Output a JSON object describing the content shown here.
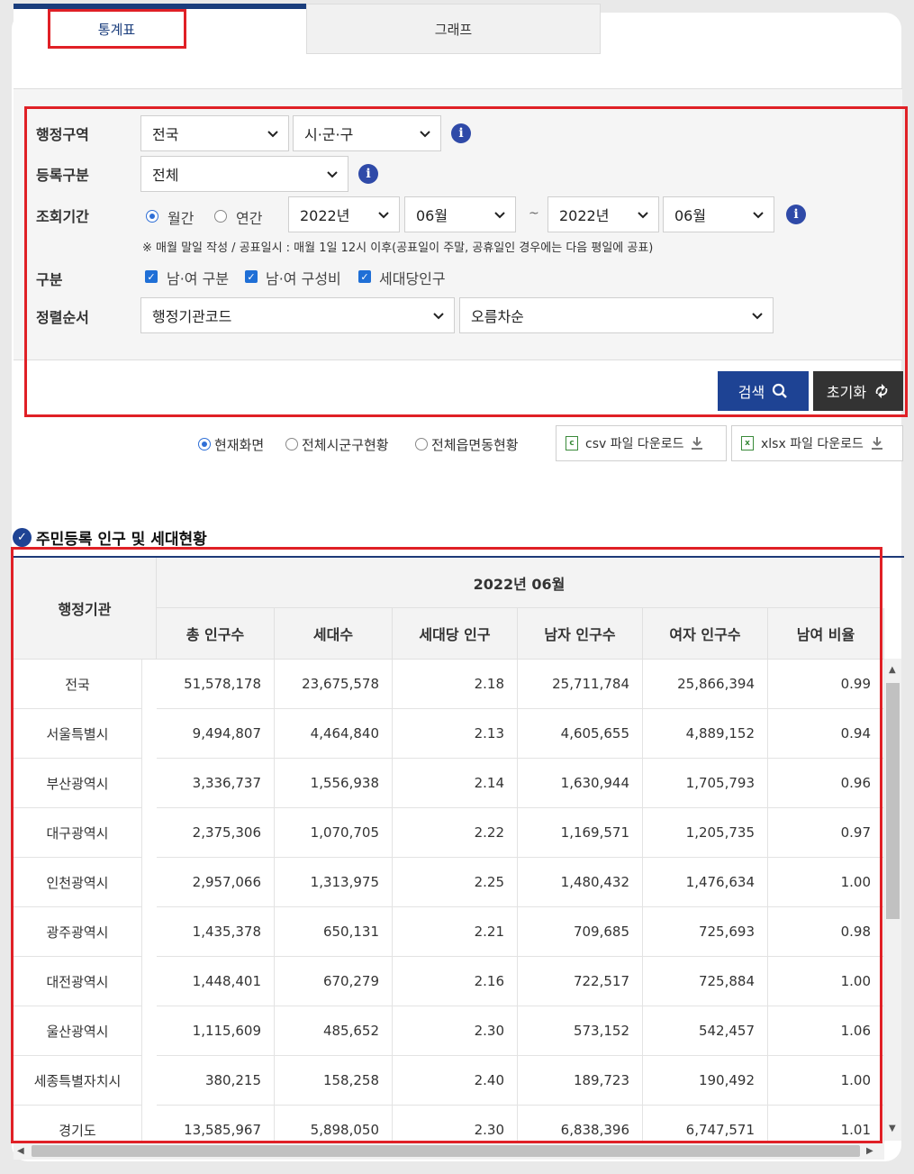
{
  "tabs": {
    "table": "통계표",
    "graph": "그래프"
  },
  "filters": {
    "region_label": "행정구역",
    "region_value": "전국",
    "district_value": "시·군·구",
    "reg_label": "등록구분",
    "reg_value": "전체",
    "period_label": "조회기간",
    "period_monthly": "월간",
    "period_yearly": "연간",
    "from_year": "2022년",
    "from_month": "06월",
    "tilde": "~",
    "to_year": "2022년",
    "to_month": "06월",
    "note": "※ 매월 말일 작성 / 공표일시 : 매월 1일 12시 이후(공표일이 주말, 공휴일인 경우에는 다음 평일에 공표)",
    "category_label": "구분",
    "cat1": "남·여 구분",
    "cat2": "남·여 구성비",
    "cat3": "세대당인구",
    "sort_label": "정렬순서",
    "sort_field": "행정기관코드",
    "sort_order": "오름차순"
  },
  "buttons": {
    "search": "검색",
    "reset": "초기화"
  },
  "view_options": {
    "current": "현재화면",
    "all_sigungu": "전체시군구현황",
    "all_eupmyeondong": "전체읍면동현황"
  },
  "downloads": {
    "csv": "csv 파일 다운로드",
    "xlsx": "xlsx 파일 다운로드",
    "csv_icon": "c",
    "xlsx_icon": "x"
  },
  "section_title": "주민등록 인구 및 세대현황",
  "table": {
    "org_header": "행정기관",
    "period_header": "2022년 06월",
    "columns": [
      "총 인구수",
      "세대수",
      "세대당 인구",
      "남자 인구수",
      "여자 인구수",
      "남여 비율"
    ],
    "rows": [
      {
        "name": "전국",
        "values": [
          "51,578,178",
          "23,675,578",
          "2.18",
          "25,711,784",
          "25,866,394",
          "0.99"
        ]
      },
      {
        "name": "서울특별시",
        "values": [
          "9,494,807",
          "4,464,840",
          "2.13",
          "4,605,655",
          "4,889,152",
          "0.94"
        ]
      },
      {
        "name": "부산광역시",
        "values": [
          "3,336,737",
          "1,556,938",
          "2.14",
          "1,630,944",
          "1,705,793",
          "0.96"
        ]
      },
      {
        "name": "대구광역시",
        "values": [
          "2,375,306",
          "1,070,705",
          "2.22",
          "1,169,571",
          "1,205,735",
          "0.97"
        ]
      },
      {
        "name": "인천광역시",
        "values": [
          "2,957,066",
          "1,313,975",
          "2.25",
          "1,480,432",
          "1,476,634",
          "1.00"
        ]
      },
      {
        "name": "광주광역시",
        "values": [
          "1,435,378",
          "650,131",
          "2.21",
          "709,685",
          "725,693",
          "0.98"
        ]
      },
      {
        "name": "대전광역시",
        "values": [
          "1,448,401",
          "670,279",
          "2.16",
          "722,517",
          "725,884",
          "1.00"
        ]
      },
      {
        "name": "울산광역시",
        "values": [
          "1,115,609",
          "485,652",
          "2.30",
          "573,152",
          "542,457",
          "1.06"
        ]
      },
      {
        "name": "세종특별자치시",
        "values": [
          "380,215",
          "158,258",
          "2.40",
          "189,723",
          "190,492",
          "1.00"
        ]
      },
      {
        "name": "경기도",
        "values": [
          "13,585,967",
          "5,898,050",
          "2.30",
          "6,838,396",
          "6,747,571",
          "1.01"
        ]
      }
    ]
  },
  "colors": {
    "primary": "#1e4394",
    "highlight": "#e02026",
    "dark_button": "#333333"
  }
}
